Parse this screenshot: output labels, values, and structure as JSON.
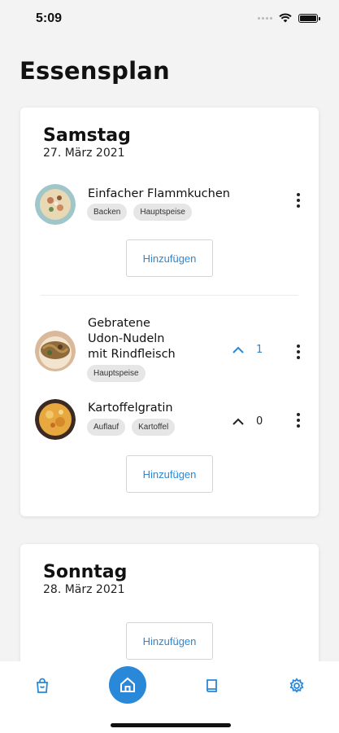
{
  "status_bar": {
    "time": "5:09"
  },
  "page": {
    "title": "Essensplan"
  },
  "days": [
    {
      "name": "Samstag",
      "date": "27. März 2021",
      "meals": [
        {
          "name": "Einfacher Flammkuchen",
          "tags": [
            "Backen",
            "Hauptspeise"
          ]
        }
      ],
      "add_label": "Hinzufügen",
      "vote_meals": [
        {
          "name": "Gebratene Udon-Nudeln mit Rindfleisch",
          "name_lines": [
            "Gebratene",
            "Udon-Nudeln",
            "mit Rindfleisch"
          ],
          "tags": [
            "Hauptspeise"
          ],
          "votes": "1"
        },
        {
          "name": "Kartoffelgratin",
          "tags": [
            "Auflauf",
            "Kartoffel"
          ],
          "votes": "0"
        }
      ],
      "add_label_2": "Hinzufügen"
    },
    {
      "name": "Sonntag",
      "date": "28. März 2021",
      "add_label": "Hinzufügen"
    }
  ],
  "colors": {
    "accent": "#2a88d8",
    "background": "#f3f3f3",
    "tag_bg": "#e6e6e6"
  },
  "nav": [
    {
      "name": "shopping-bag-icon"
    },
    {
      "name": "home-icon",
      "active": true
    },
    {
      "name": "book-icon"
    },
    {
      "name": "gear-icon"
    }
  ]
}
